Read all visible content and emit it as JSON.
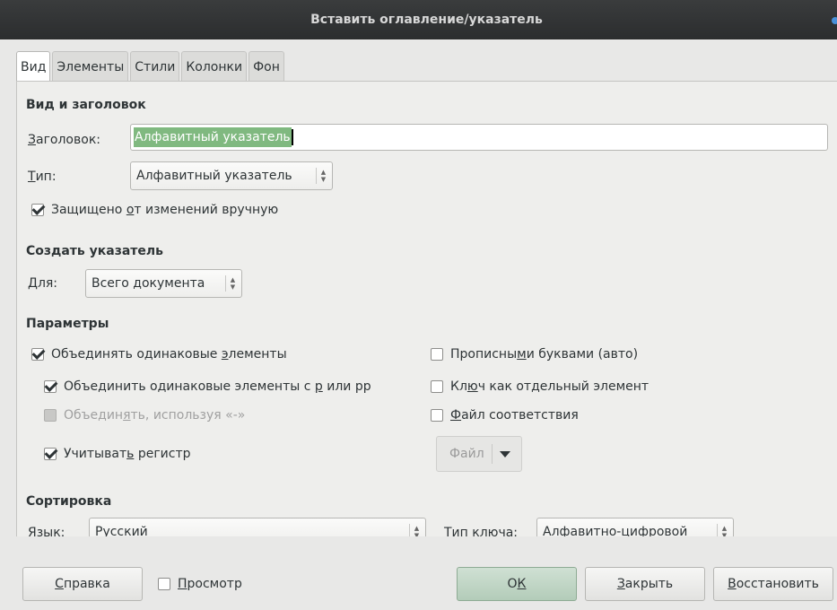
{
  "window": {
    "title": "Вставить оглавление/указатель"
  },
  "tabs": [
    {
      "label": "Вид",
      "active": true
    },
    {
      "label": "Элементы"
    },
    {
      "label": "Стили"
    },
    {
      "label": "Колонки"
    },
    {
      "label": "Фон"
    }
  ],
  "view": {
    "section_title": "Вид и заголовок",
    "heading_label_mn": "З",
    "heading_label_rest": "аголовок:",
    "heading_value": "Алфавитный указатель",
    "type_label_mn": "Т",
    "type_label_rest": "ип:",
    "type_value": "Алфавитный указатель",
    "protected_pre": "Защищено ",
    "protected_mn": "о",
    "protected_post": "т изменений вручную",
    "protected_checked": true
  },
  "create": {
    "section_title": "Создать указатель",
    "for_label_mn": "Д",
    "for_label_rest": "ля:",
    "for_value": "Всего документа"
  },
  "params": {
    "section_title": "Параметры",
    "combine_identical_pre": "Объединять одинаковые ",
    "combine_identical_mn": "э",
    "combine_identical_post": "лементы",
    "combine_p_pre": "Объединить одинаковые элементы с ",
    "combine_p_mn": "р",
    "combine_p_post": " или рр",
    "combine_dash_pre": "Объедин",
    "combine_dash_mn": "я",
    "combine_dash_post": "ть, используя «-»",
    "case_pre": "Учитыват",
    "case_mn": "ь",
    "case_post": " регистр",
    "caps_pre": "Прописны",
    "caps_mn": "м",
    "caps_post": "и буквами (авто)",
    "key_pre": "Кл",
    "key_mn": "ю",
    "key_post": "ч как отдельный элемент",
    "concordance_mn": "Ф",
    "concordance_post": "айл соответствия",
    "file_button": "Файл"
  },
  "sort": {
    "section_title": "Сортировка",
    "language_label": "Язык:",
    "language_value": "Русский",
    "key_type_label": "Тип ключа:",
    "key_type_value": "Алфавитно-цифровой"
  },
  "buttons": {
    "help_mn": "С",
    "help_rest": "правка",
    "preview_mn": "П",
    "preview_rest": "росмотр",
    "ok_pre": "О",
    "ok_mn": "К",
    "close_mn": "З",
    "close_rest": "акрыть",
    "reset_mn": "В",
    "reset_rest": "осстановить"
  }
}
